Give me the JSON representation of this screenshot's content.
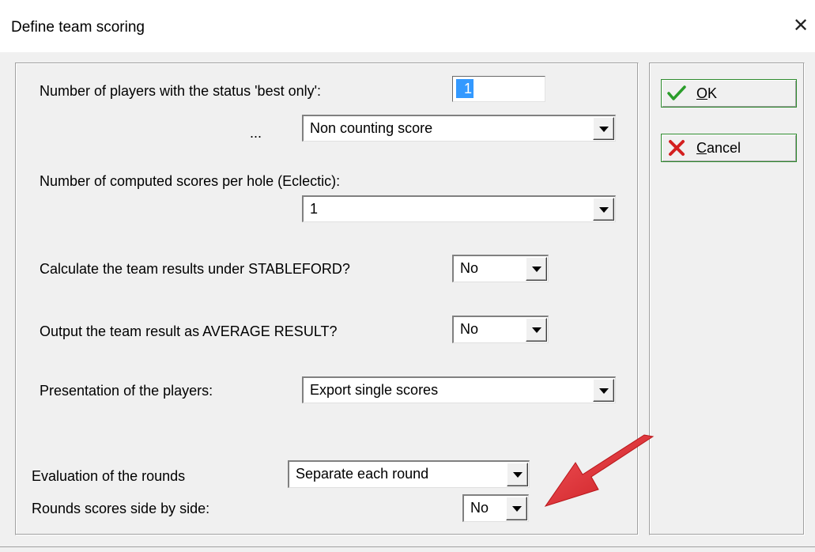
{
  "window": {
    "title": "Define team scoring",
    "close_glyph": "✕"
  },
  "fields": {
    "best_only_label": "Number of players with the status 'best only':",
    "best_only_value": "1",
    "ellipsis": "...",
    "best_only_mode": "Non counting score",
    "eclectic_label": "Number of computed scores per hole (Eclectic):",
    "eclectic_value": "1",
    "stableford_label": "Calculate the team results under STABLEFORD?",
    "stableford_value": "No",
    "average_label": "Output the team result as AVERAGE RESULT?",
    "average_value": "No",
    "presentation_label": "Presentation of the players:",
    "presentation_value": "Export single scores",
    "rounds_eval_label": "Evaluation of the rounds",
    "rounds_eval_value": "Separate each round",
    "side_by_side_label": "Rounds scores side by side:",
    "side_by_side_value": "No"
  },
  "buttons": {
    "ok": {
      "first": "O",
      "rest": "K",
      "icon": "checkmark-icon"
    },
    "cancel": {
      "first": "C",
      "rest": "ancel",
      "icon": "red-x-icon"
    }
  },
  "colors": {
    "selection": "#3399ff",
    "ok_check": "#2a9d2a",
    "cancel_x": "#d42020",
    "annotation_arrow": "#e8262a"
  }
}
